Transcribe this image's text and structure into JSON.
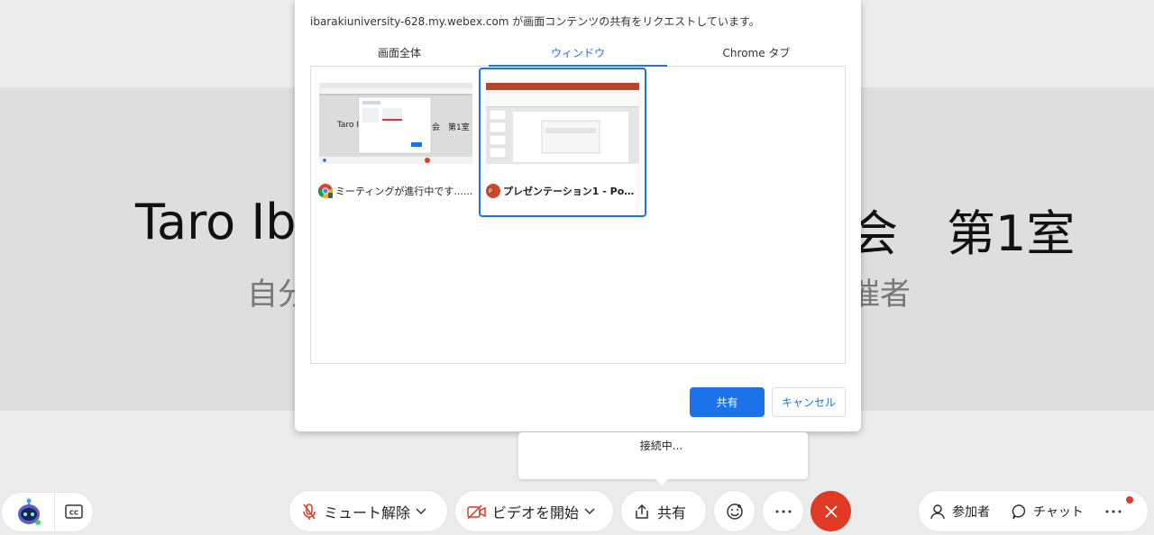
{
  "stage": {
    "title_left": "Taro Ib",
    "title_right": "会　第1室",
    "subtitle_left": "自分",
    "subtitle_right": "催者"
  },
  "dialog": {
    "message": "ibarakiuniversity-628.my.webex.com が画面コンテンツの共有をリクエストしています。",
    "tabs": [
      {
        "label": "画面全体",
        "active": false
      },
      {
        "label": "ウィンドウ",
        "active": true
      },
      {
        "label": "Chrome タブ",
        "active": false
      }
    ],
    "windows": [
      {
        "label": "ミーティングが進行中です......",
        "icon": "chrome-icon",
        "selected": false,
        "thumb_title": "Taro I",
        "thumb_title_right": "会　第1室"
      },
      {
        "label": "プレゼンテーション1 - Powe...",
        "icon": "powerpoint-icon",
        "selected": true
      }
    ],
    "share_label": "共有",
    "cancel_label": "キャンセル"
  },
  "tooltip": {
    "text": "接続中..."
  },
  "toolbar": {
    "mute_label": "ミュート解除",
    "video_label": "ビデオを開始",
    "share_label": "共有",
    "participants_label": "参加者",
    "chat_label": "チャット"
  },
  "colors": {
    "accent": "#1a73e8",
    "danger": "#e03a26",
    "chrome_red": "#db4437",
    "chrome_yellow": "#f4b400",
    "chrome_green": "#0f9d58",
    "ppt_orange": "#d24726"
  }
}
